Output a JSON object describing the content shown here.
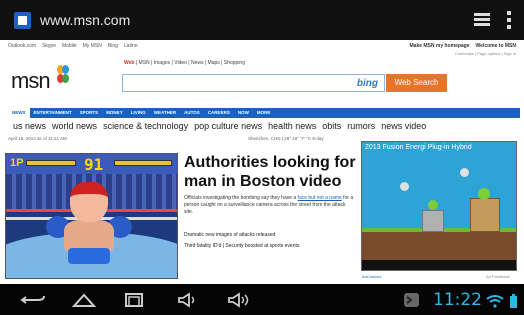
{
  "browser": {
    "url": "www.msn.com",
    "icons": [
      "msn-favicon",
      "tabs-icon",
      "overflow-menu-icon"
    ]
  },
  "header": {
    "top_links": [
      "Outlook.com",
      "Skype",
      "Mobile",
      "My MSN",
      "Bing",
      "Latino"
    ],
    "top_right_links": [
      "Make MSN my homepage",
      "Welcome to MSN"
    ],
    "top_right_sub": "Customize | Page options | Sign in"
  },
  "logo": {
    "text": "msn"
  },
  "search": {
    "tabs_label": "Web",
    "tabs_rest": " | MSN | Images | Video | News | Maps | Shopping",
    "engine_label": "bing",
    "button_label": "Web Search",
    "colors": {
      "button": "#e8742a",
      "border": "#8fb4dd"
    }
  },
  "navbar": {
    "items": [
      "NEWS",
      "ENTERTAINMENT",
      "SPORTS",
      "MONEY",
      "LIVING",
      "WEATHER",
      "AUTOS",
      "CAREERS",
      "NOW",
      "MORE"
    ],
    "color": "#1a63b8"
  },
  "subnav": {
    "items": [
      "us news",
      "world news",
      "science & technology",
      "pop culture news",
      "health news",
      "obits",
      "rumors",
      "news video"
    ]
  },
  "info": {
    "date": "April 18, 2013 as of 11:21 AM",
    "weather": "Shenzhen, CHN | 29° 19° °F °C  5-day"
  },
  "game": {
    "score_label": "1P",
    "timer": "91"
  },
  "story": {
    "headline": "Authorities looking for man in Boston video",
    "body_prefix": "Officials investigating the bombing say they have a ",
    "body_link": "face but not a name",
    "body_suffix": " for a person caught on a surveillance camera across the street from the attack site.",
    "related": [
      "Dramatic new images of attacks released",
      "Third fatality ID'd | Security boosted at sports events"
    ]
  },
  "ad": {
    "title": "2013 Fusion Energi Plug-in Hybrid",
    "choices_label": "AdChoices",
    "feedback_label": "Ad Feedback"
  },
  "system_bar": {
    "time": "11:22",
    "icons": [
      "back-icon",
      "home-icon",
      "recent-apps-icon",
      "volume-down-icon",
      "volume-up-icon",
      "debug-icon",
      "wifi-icon",
      "battery-icon"
    ],
    "accent": "#33b5e5"
  }
}
